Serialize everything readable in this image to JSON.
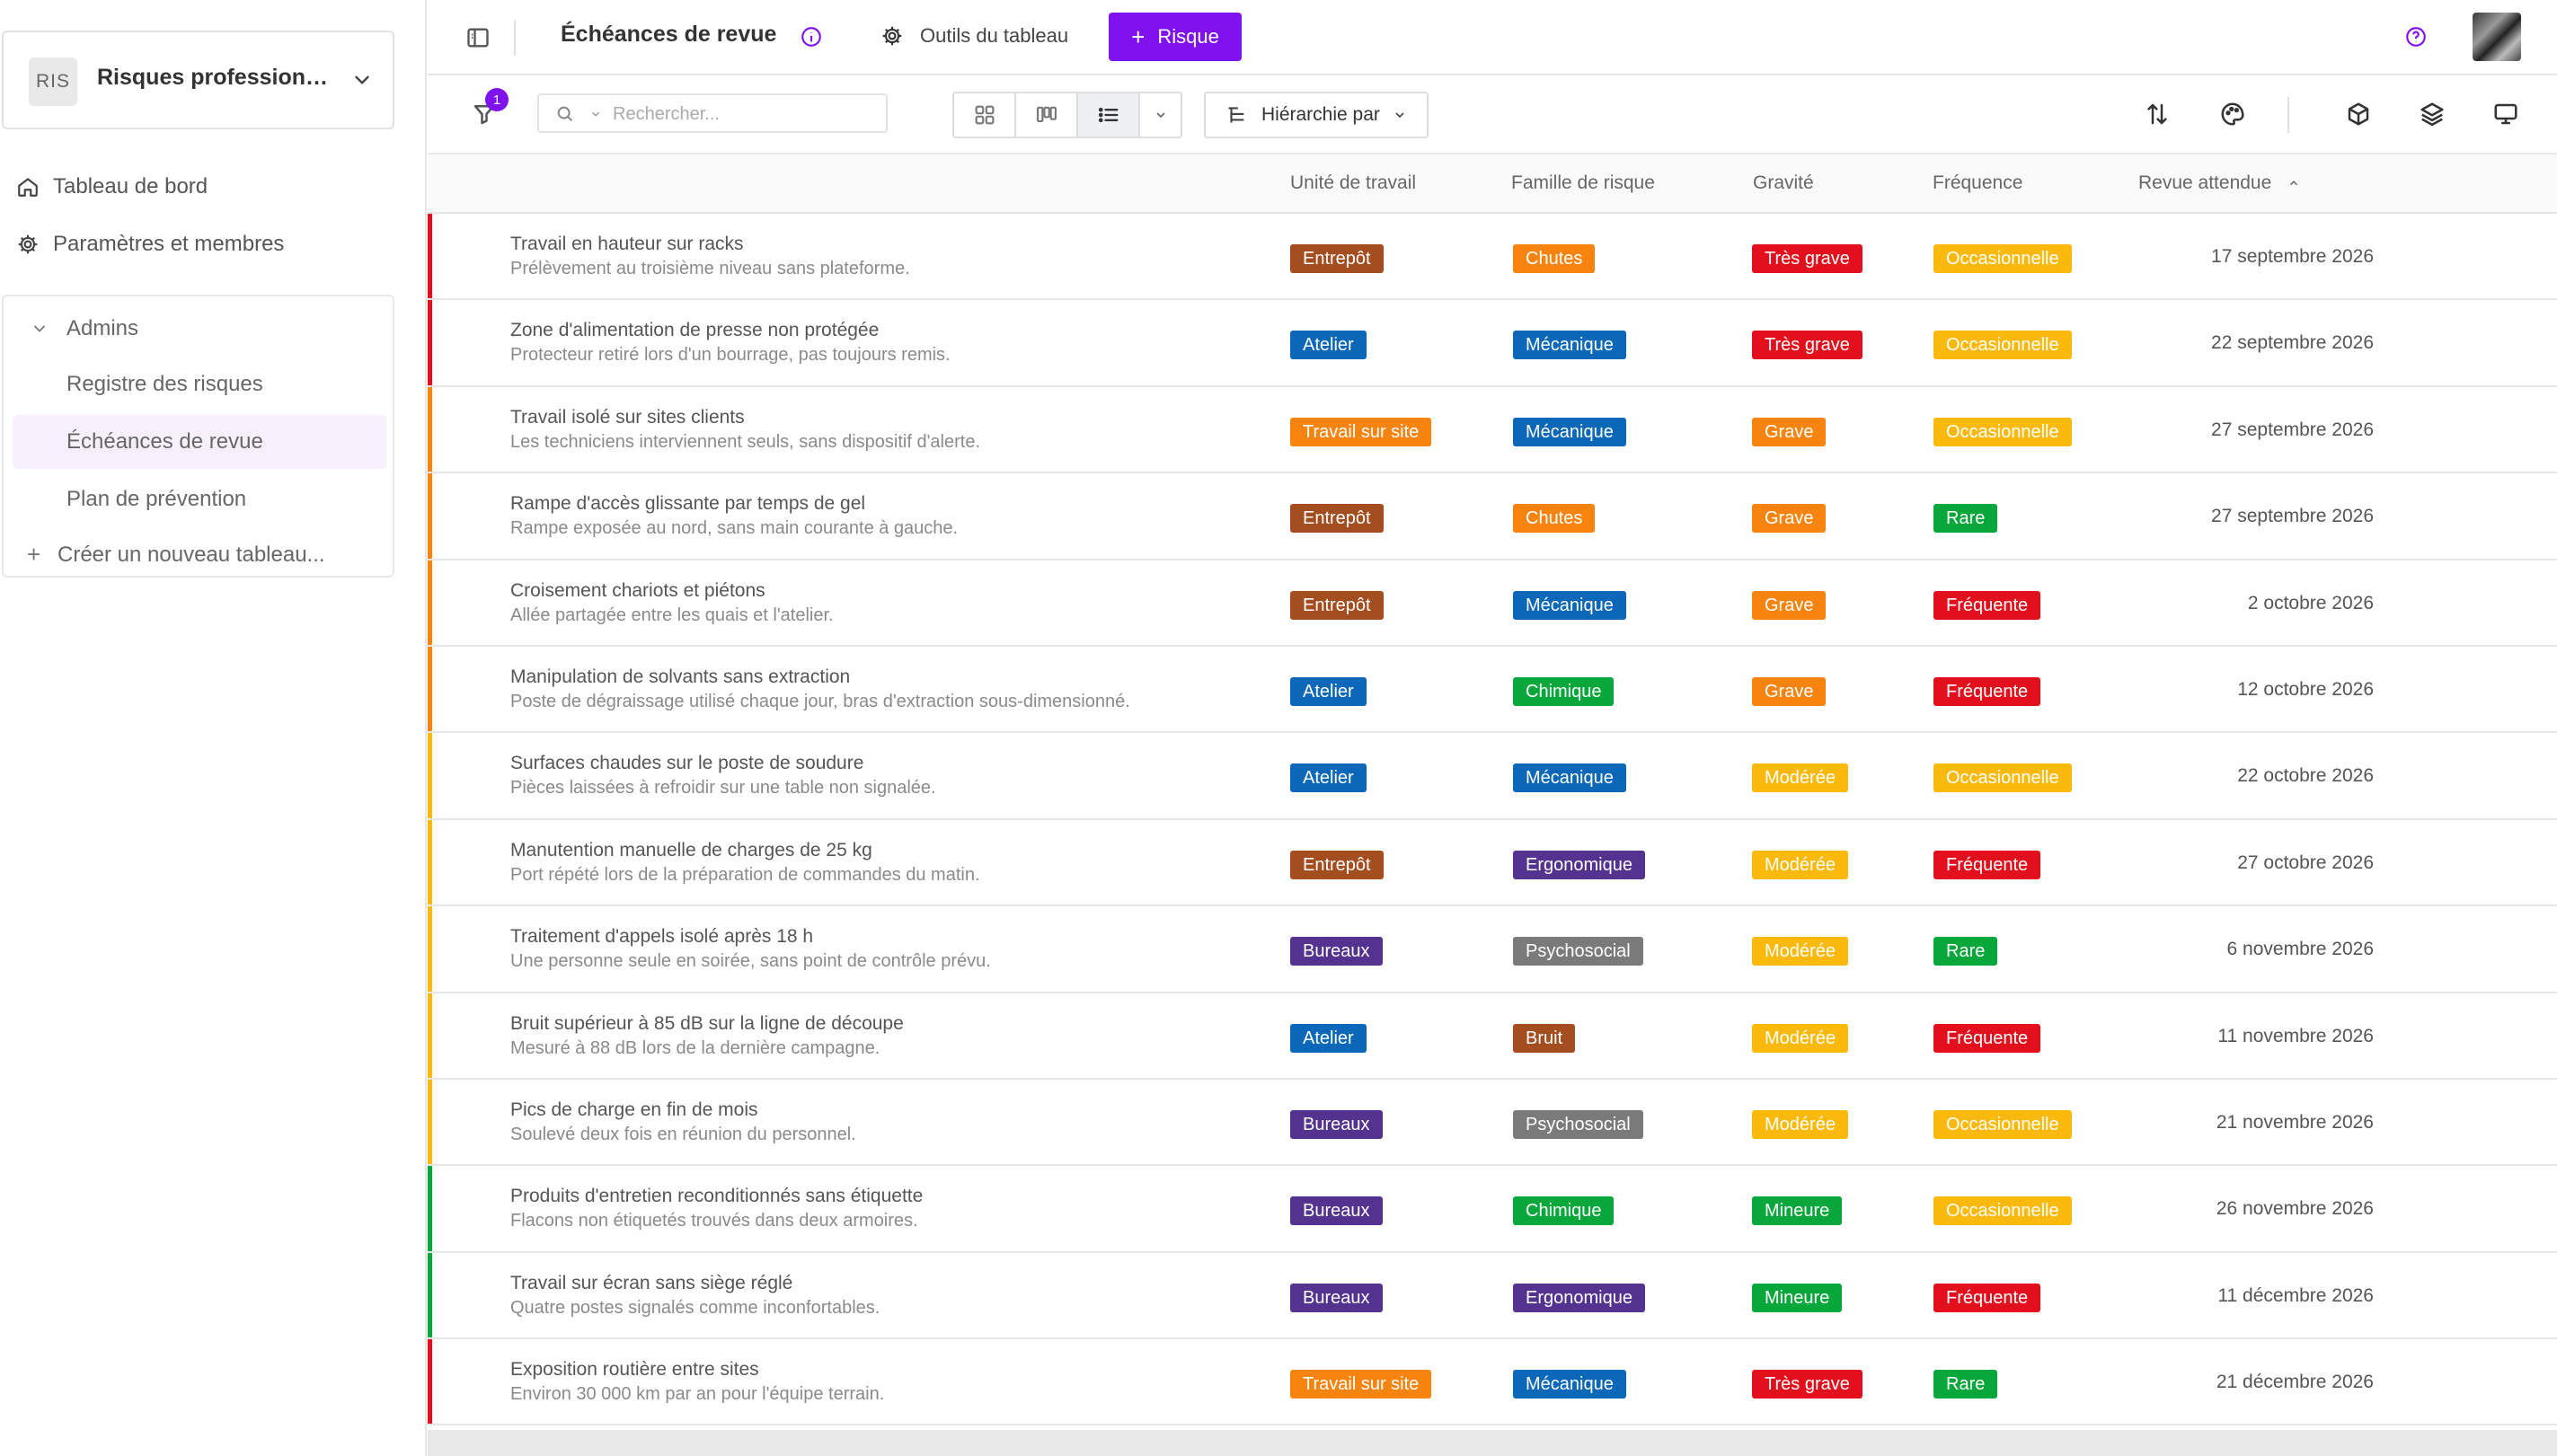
{
  "workspace": {
    "badge": "RIS",
    "name": "Risques professionnels"
  },
  "nav": {
    "dashboard": "Tableau de bord",
    "settings": "Paramètres et membres"
  },
  "group": {
    "title": "Admins",
    "items": [
      "Registre des risques",
      "Échéances de revue",
      "Plan de prévention"
    ],
    "active_index": 1,
    "create": "Créer un nouveau tableau..."
  },
  "topbar": {
    "title": "Échéances de revue",
    "tools": "Outils du tableau",
    "add": "Risque"
  },
  "toolbar": {
    "filter_count": "1",
    "search_placeholder": "Rechercher...",
    "hierarchy": "Hiérarchie par"
  },
  "columns": {
    "unit": "Unité de travail",
    "family": "Famille de risque",
    "severity": "Gravité",
    "frequency": "Fréquence",
    "review": "Revue attendue"
  },
  "colors": {
    "accent": "#7f12ee",
    "units": {
      "Entrepôt": "#a44d1e",
      "Atelier": "#0b68b8",
      "Travail sur site": "#f7840f",
      "Bureaux": "#54328f"
    },
    "families": {
      "Chutes": "#f7840f",
      "Mécanique": "#0b68b8",
      "Chimique": "#08a73c",
      "Ergonomique": "#54328f",
      "Psychosocial": "#7a7a7a",
      "Bruit": "#a44d1e"
    },
    "severities": {
      "Très grave": "#e30f1d",
      "Grave": "#f7840f",
      "Modérée": "#fbb90c",
      "Mineure": "#08a73c"
    },
    "frequencies": {
      "Occasionnelle": "#fbb90c",
      "Rare": "#08a73c",
      "Fréquente": "#e30f1d"
    }
  },
  "rows": [
    {
      "title": "Travail en hauteur sur racks",
      "desc": "Prélèvement au troisième niveau sans plateforme.",
      "unit": "Entrepôt",
      "family": "Chutes",
      "severity": "Très grave",
      "frequency": "Occasionnelle",
      "review": "17 septembre 2026"
    },
    {
      "title": "Zone d'alimentation de presse non protégée",
      "desc": "Protecteur retiré lors d'un bourrage, pas toujours remis.",
      "unit": "Atelier",
      "family": "Mécanique",
      "severity": "Très grave",
      "frequency": "Occasionnelle",
      "review": "22 septembre 2026"
    },
    {
      "title": "Travail isolé sur sites clients",
      "desc": "Les techniciens interviennent seuls, sans dispositif d'alerte.",
      "unit": "Travail sur site",
      "family": "Mécanique",
      "severity": "Grave",
      "frequency": "Occasionnelle",
      "review": "27 septembre 2026"
    },
    {
      "title": "Rampe d'accès glissante par temps de gel",
      "desc": "Rampe exposée au nord, sans main courante à gauche.",
      "unit": "Entrepôt",
      "family": "Chutes",
      "severity": "Grave",
      "frequency": "Rare",
      "review": "27 septembre 2026"
    },
    {
      "title": "Croisement chariots et piétons",
      "desc": "Allée partagée entre les quais et l'atelier.",
      "unit": "Entrepôt",
      "family": "Mécanique",
      "severity": "Grave",
      "frequency": "Fréquente",
      "review": "2 octobre 2026"
    },
    {
      "title": "Manipulation de solvants sans extraction",
      "desc": "Poste de dégraissage utilisé chaque jour, bras d'extraction sous-dimensionné.",
      "unit": "Atelier",
      "family": "Chimique",
      "severity": "Grave",
      "frequency": "Fréquente",
      "review": "12 octobre 2026"
    },
    {
      "title": "Surfaces chaudes sur le poste de soudure",
      "desc": "Pièces laissées à refroidir sur une table non signalée.",
      "unit": "Atelier",
      "family": "Mécanique",
      "severity": "Modérée",
      "frequency": "Occasionnelle",
      "review": "22 octobre 2026"
    },
    {
      "title": "Manutention manuelle de charges de 25 kg",
      "desc": "Port répété lors de la préparation de commandes du matin.",
      "unit": "Entrepôt",
      "family": "Ergonomique",
      "severity": "Modérée",
      "frequency": "Fréquente",
      "review": "27 octobre 2026"
    },
    {
      "title": "Traitement d'appels isolé après 18 h",
      "desc": "Une personne seule en soirée, sans point de contrôle prévu.",
      "unit": "Bureaux",
      "family": "Psychosocial",
      "severity": "Modérée",
      "frequency": "Rare",
      "review": "6 novembre 2026"
    },
    {
      "title": "Bruit supérieur à 85 dB sur la ligne de découpe",
      "desc": "Mesuré à 88 dB lors de la dernière campagne.",
      "unit": "Atelier",
      "family": "Bruit",
      "severity": "Modérée",
      "frequency": "Fréquente",
      "review": "11 novembre 2026"
    },
    {
      "title": "Pics de charge en fin de mois",
      "desc": "Soulevé deux fois en réunion du personnel.",
      "unit": "Bureaux",
      "family": "Psychosocial",
      "severity": "Modérée",
      "frequency": "Occasionnelle",
      "review": "21 novembre 2026"
    },
    {
      "title": "Produits d'entretien reconditionnés sans étiquette",
      "desc": "Flacons non étiquetés trouvés dans deux armoires.",
      "unit": "Bureaux",
      "family": "Chimique",
      "severity": "Mineure",
      "frequency": "Occasionnelle",
      "review": "26 novembre 2026"
    },
    {
      "title": "Travail sur écran sans siège réglé",
      "desc": "Quatre postes signalés comme inconfortables.",
      "unit": "Bureaux",
      "family": "Ergonomique",
      "severity": "Mineure",
      "frequency": "Fréquente",
      "review": "11 décembre 2026"
    },
    {
      "title": "Exposition routière entre sites",
      "desc": "Environ 30 000 km par an pour l'équipe terrain.",
      "unit": "Travail sur site",
      "family": "Mécanique",
      "severity": "Très grave",
      "frequency": "Rare",
      "review": "21 décembre 2026"
    }
  ]
}
